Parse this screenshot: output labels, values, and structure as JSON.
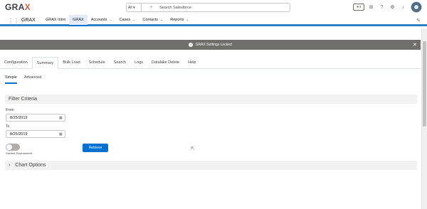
{
  "header": {
    "logo_main": "GRA",
    "logo_accent": "X",
    "search_scope": "All ▾",
    "search_placeholder": "Search Salesforce",
    "icons": [
      "favorites-icon",
      "add-icon",
      "help-icon",
      "settings-icon",
      "notifications-icon",
      "avatar"
    ]
  },
  "nav": {
    "app_name": "GRAX",
    "items": [
      {
        "label": "GRAX Intro",
        "has_menu": false
      },
      {
        "label": "GRAX",
        "has_menu": false,
        "active": true
      },
      {
        "label": "Accounts",
        "has_menu": true
      },
      {
        "label": "Cases",
        "has_menu": true
      },
      {
        "label": "Contacts",
        "has_menu": true
      },
      {
        "label": "Reports",
        "has_menu": true
      }
    ]
  },
  "banner": {
    "text": "GRAX Settings Locked",
    "info_glyph": "i",
    "close_glyph": "✕"
  },
  "tabs": [
    "Configuration",
    "Summary",
    "Bulk Load",
    "Schedule",
    "Search",
    "Logs",
    "Datalake Delete",
    "Help"
  ],
  "active_tab": "Summary",
  "subtabs": [
    "Simple",
    "Advanced"
  ],
  "active_subtab": "Simple",
  "filter": {
    "title": "Filter Criteria",
    "from_label": "From",
    "from_value": "8/25/2019",
    "to_label": "To",
    "to_value": "8/25/2019",
    "toggle_label": "Current Environment",
    "retrieve_label": "Retrieve"
  },
  "chart_options": {
    "title": "Chart Options"
  },
  "colors": {
    "brand": "#0070d2",
    "nav_underline": "#2b82c8",
    "banner": "#706e6b",
    "logo_accent": "#e45b3b"
  }
}
